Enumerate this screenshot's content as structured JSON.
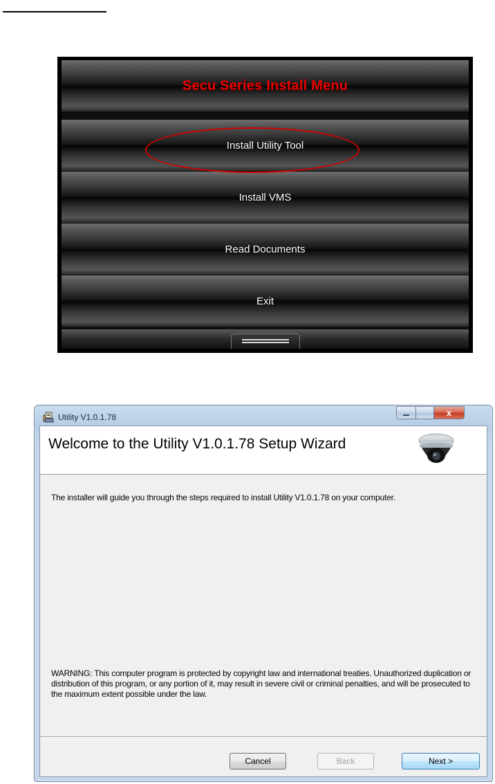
{
  "install_menu": {
    "title": "Secu Series Install Menu",
    "items": [
      {
        "label": "Install Utility Tool"
      },
      {
        "label": "Install VMS"
      },
      {
        "label": "Read Documents"
      },
      {
        "label": "Exit"
      }
    ],
    "highlight_color": "#d00000",
    "title_color": "#e60000"
  },
  "wizard": {
    "window_title": "Utility V1.0.1.78",
    "window_icon": "installer-icon",
    "heading": "Welcome to the Utility V1.0.1.78 Setup Wizard",
    "banner_image": "dome-camera-icon",
    "intro": "The installer will guide you through the steps required to install Utility V1.0.1.78 on your computer.",
    "warning": "WARNING: This computer program is protected by copyright law and international treaties. Unauthorized duplication or distribution of this program, or any portion of it, may result in severe civil or criminal penalties, and will be prosecuted to the maximum extent possible under the law.",
    "buttons": {
      "cancel": "Cancel",
      "back": "Back",
      "next": "Next >"
    },
    "controls": {
      "close": "x"
    }
  }
}
